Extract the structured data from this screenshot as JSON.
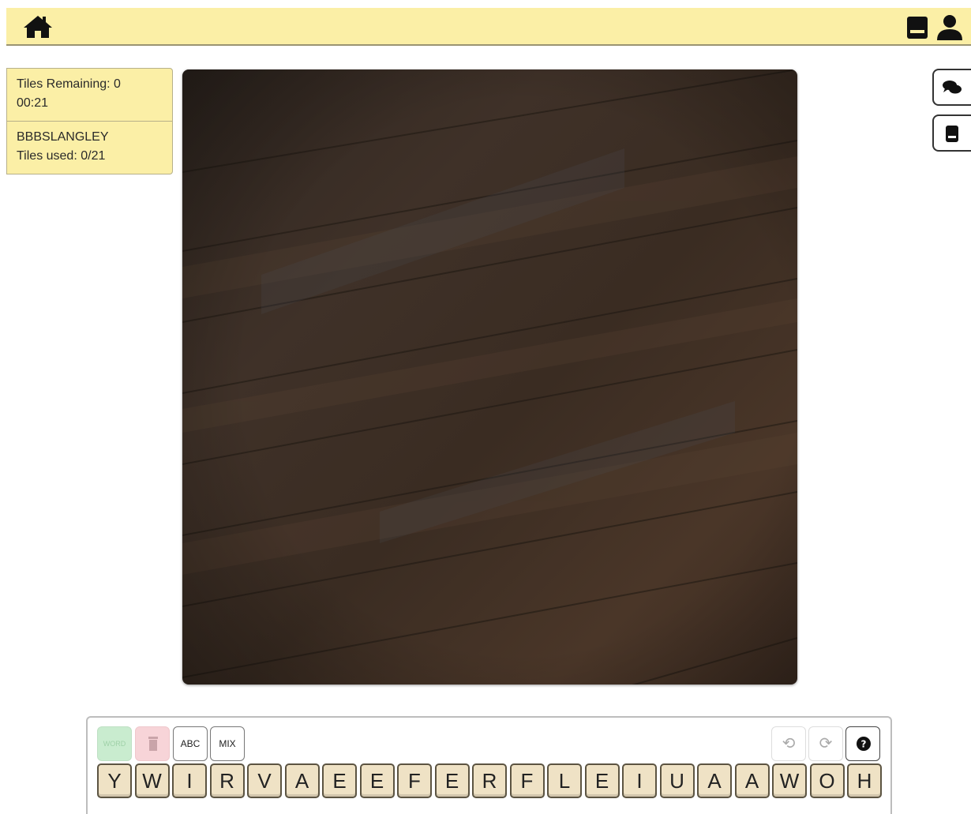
{
  "topbar": {
    "home_icon": "home-icon",
    "book_icon": "book-icon",
    "user_icon": "user-icon",
    "background": "#fbefa6"
  },
  "status": {
    "tiles_remaining": "Tiles Remaining: 0",
    "timer": "00:21",
    "player": "BBBSLANGLEY",
    "tiles_used": "Tiles used: 0/21"
  },
  "side_buttons": [
    {
      "icon": "chat-icon"
    },
    {
      "icon": "book-icon"
    }
  ],
  "board": {
    "texture": "dark wood",
    "colors": [
      "#3b2c22",
      "#2d2620",
      "#4a3a2c"
    ]
  },
  "controls": {
    "word_label": "WORD",
    "abc_label": "ABC",
    "mix_label": "MIX",
    "undo_symbol": "⟲",
    "redo_symbol": "⟳",
    "help_symbol": "?"
  },
  "tiles": [
    "Y",
    "W",
    "I",
    "R",
    "V",
    "A",
    "E",
    "E",
    "F",
    "E",
    "R",
    "F",
    "L",
    "E",
    "I",
    "U",
    "A",
    "A",
    "W",
    "O",
    "H"
  ]
}
